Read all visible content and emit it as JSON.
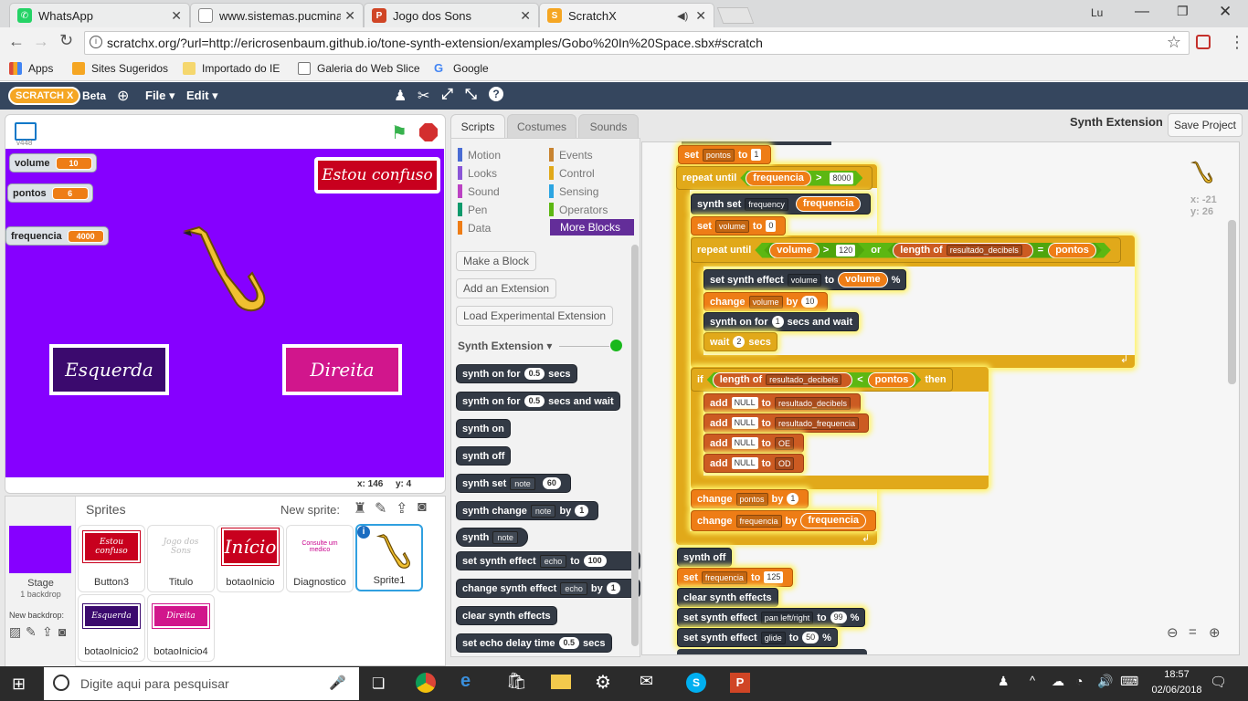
{
  "browser": {
    "tabs": [
      {
        "title": "WhatsApp",
        "favicon_color": "#25d366"
      },
      {
        "title": "www.sistemas.pucminas.b",
        "favicon_color": "#888888"
      },
      {
        "title": "Jogo dos Sons",
        "favicon_color": "#d04525",
        "favicon_letter": "P"
      },
      {
        "title": "ScratchX",
        "favicon_color": "#f5a623"
      }
    ],
    "url": "scratchx.org/?url=http://ericrosenbaum.github.io/tone-synth-extension/examples/Gobo%20In%20Space.sbx#scratch",
    "bookmarks": [
      {
        "label": "Apps",
        "color": "#dd4b39"
      },
      {
        "label": "Sites Sugeridos",
        "color": "#f5a623"
      },
      {
        "label": "Importado do IE",
        "color": "#f5d76e"
      },
      {
        "label": "Galeria do Web Slice",
        "color": "#ffffff"
      },
      {
        "label": "Google",
        "color": "#4285f4"
      }
    ]
  },
  "scratch": {
    "logo": "SCRATCH X",
    "beta": "Beta",
    "menu_file": "File ▾",
    "menu_edit": "Edit ▾",
    "project_title": "Synth Extension",
    "save_project": "Save Project",
    "version": "v448",
    "tabs": [
      "Scripts",
      "Costumes",
      "Sounds"
    ],
    "stage": {
      "watchers": [
        {
          "label": "volume",
          "value": "10"
        },
        {
          "label": "pontos",
          "value": "6"
        },
        {
          "label": "frequencia",
          "value": "4000"
        }
      ],
      "estou_confuso": "Estou confuso",
      "esquerda": "Esquerda",
      "direita": "Direita",
      "mouse_x": "x: 146",
      "mouse_y": "y: 4"
    },
    "sprites_header": "Sprites",
    "new_sprite": "New sprite:",
    "stage_label": "Stage",
    "backdrop_count": "1 backdrop",
    "new_backdrop": "New backdrop:",
    "sprites": [
      {
        "name": "Button3",
        "pic": "Estou confuso",
        "bg": "#c8001e"
      },
      {
        "name": "Titulo",
        "pic": "Jogo dos Sons",
        "bg": "#ffffff"
      },
      {
        "name": "botaoInicio",
        "pic": "Início",
        "bg": "#c8001e"
      },
      {
        "name": "Diagnostico",
        "pic": "Consulte um medico",
        "bg": "#ffffff"
      },
      {
        "name": "Sprite1",
        "pic": "",
        "bg": "#ffffff"
      },
      {
        "name": "botaoInicio2",
        "pic": "Esquerda",
        "bg": "#3b0a6e"
      },
      {
        "name": "botaoInicio4",
        "pic": "Direita",
        "bg": "#d1168c"
      }
    ],
    "categories": [
      {
        "label": "Motion",
        "color": "#4a6cd4"
      },
      {
        "label": "Events",
        "color": "#c88330"
      },
      {
        "label": "Looks",
        "color": "#8a55d7"
      },
      {
        "label": "Control",
        "color": "#e1a91a"
      },
      {
        "label": "Sound",
        "color": "#bb42c3"
      },
      {
        "label": "Sensing",
        "color": "#2ca5e2"
      },
      {
        "label": "Pen",
        "color": "#0e9a6c"
      },
      {
        "label": "Operators",
        "color": "#5cb712"
      },
      {
        "label": "Data",
        "color": "#ee7d16"
      },
      {
        "label": "More Blocks",
        "color": "#632d99"
      }
    ],
    "palette_buttons": [
      "Make a Block",
      "Add an Extension",
      "Load Experimental Extension"
    ],
    "extension_header": "Synth Extension ▾",
    "palette_blocks": [
      {
        "a": "synth on for",
        "n": "0.5",
        "b": "secs"
      },
      {
        "a": "synth on for",
        "n": "0.5",
        "b": "secs and wait"
      },
      {
        "a": "synth on"
      },
      {
        "a": "synth off"
      },
      {
        "a": "synth set",
        "d": "note",
        "n": "60"
      },
      {
        "a": "synth change",
        "d": "note",
        "b": "by",
        "n2": "1"
      },
      {
        "a": "synth",
        "d": "note"
      },
      {
        "a": "set synth effect",
        "d": "echo",
        "b": "to",
        "n2": "100"
      },
      {
        "a": "change synth effect",
        "d": "echo",
        "b": "by",
        "n2": "1"
      },
      {
        "a": "clear synth effects"
      },
      {
        "a": "set echo delay time",
        "n": "0.5",
        "b": "secs"
      }
    ],
    "sprite_xy": {
      "x": "x: -21",
      "y": "y: 26"
    },
    "script": {
      "set_pontos": {
        "kw": "set",
        "var": "pontos",
        "to": "to",
        "val": "1"
      },
      "repeat_until_1": {
        "kw": "repeat until",
        "rep": "frequencia",
        "op": ">",
        "val": "8000"
      },
      "synth_set": {
        "kw": "synth set",
        "dd": "frequency",
        "rep": "frequencia"
      },
      "set_volume": {
        "kw": "set",
        "var": "volume",
        "to": "to",
        "val": "0"
      },
      "repeat_until_2": {
        "kw": "repeat until",
        "rep": "volume",
        "op": ">",
        "val": "120",
        "or": "or",
        "len": "length of",
        "list": "resultado_decibels",
        "eq": "=",
        "rep2": "pontos"
      },
      "set_synth_effect": {
        "kw": "set synth effect",
        "dd": "volume",
        "to": "to",
        "rep": "volume",
        "pct": "%"
      },
      "change_volume": {
        "kw": "change",
        "var": "volume",
        "by": "by",
        "val": "10"
      },
      "synth_on_for": {
        "kw": "synth on for",
        "val": "1",
        "b": "secs and wait"
      },
      "wait": {
        "kw": "wait",
        "val": "2",
        "b": "secs"
      },
      "if": {
        "kw": "if",
        "len": "length of",
        "list": "resultado_decibels",
        "op": "<",
        "rep": "pontos",
        "then": "then"
      },
      "adds": [
        {
          "kw": "add",
          "val": "NULL",
          "to": "to",
          "list": "resultado_decibels"
        },
        {
          "kw": "add",
          "val": "NULL",
          "to": "to",
          "list": "resultado_frequencia"
        },
        {
          "kw": "add",
          "val": "NULL",
          "to": "to",
          "list": "OE"
        },
        {
          "kw": "add",
          "val": "NULL",
          "to": "to",
          "list": "OD"
        }
      ],
      "change_pontos": {
        "kw": "change",
        "var": "pontos",
        "by": "by",
        "val": "1"
      },
      "change_freq": {
        "kw": "change",
        "var": "frequencia",
        "by": "by",
        "rep": "frequencia"
      },
      "synth_off": "synth off",
      "set_freq": {
        "kw": "set",
        "var": "frequencia",
        "to": "to",
        "val": "125"
      },
      "clear": "clear synth effects",
      "pan": {
        "kw": "set synth effect",
        "dd": "pan left/right",
        "to": "to",
        "val": "99",
        "pct": "%"
      },
      "glide": {
        "kw": "set synth effect",
        "dd": "glide",
        "to": "to",
        "val": "50",
        "pct": "%"
      }
    }
  },
  "taskbar": {
    "search_placeholder": "Digite aqui para pesquisar",
    "time": "18:57",
    "date": "02/06/2018"
  }
}
